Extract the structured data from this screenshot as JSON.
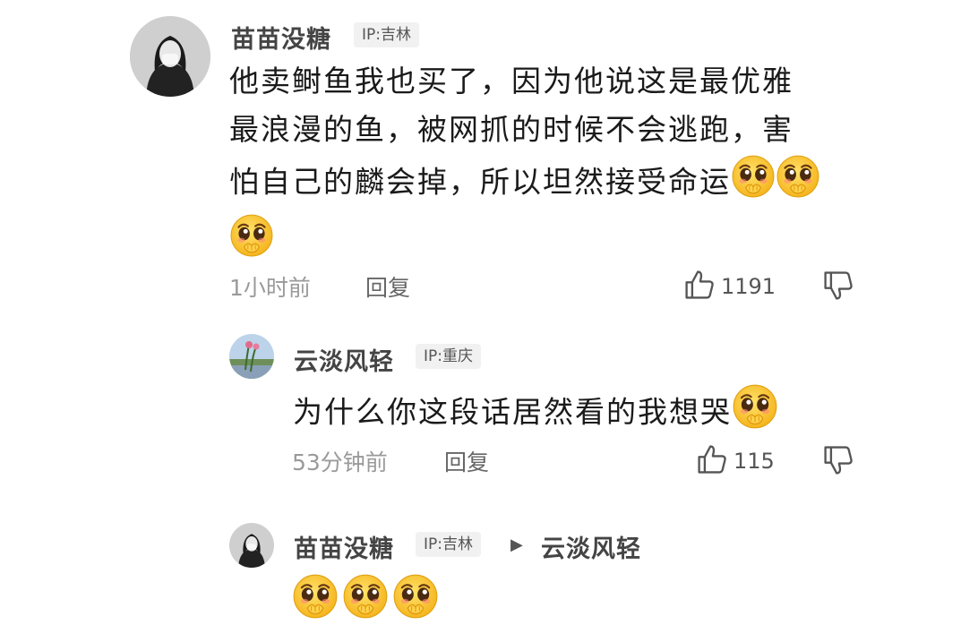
{
  "comment": {
    "user": "苗苗没糖",
    "ip": "IP:吉林",
    "lines": [
      "他卖鲥鱼我也买了，因为他说这是最优雅",
      "最浪漫的鱼，被网抓的时候不会逃跑，害",
      "怕自己的麟会掉，所以坦然接受命运"
    ],
    "time": "1小时前",
    "reply_label": "回复",
    "likes": "1191"
  },
  "reply1": {
    "user": "云淡风轻",
    "ip": "IP:重庆",
    "text": "为什么你这段话居然看的我想哭",
    "time": "53分钟前",
    "reply_label": "回复",
    "likes": "115"
  },
  "reply2": {
    "user": "苗苗没糖",
    "ip": "IP:吉林",
    "arrow": "▶",
    "target_user": "云淡风轻"
  },
  "emoji_name": "pleading-face-icon",
  "colors": {
    "emoji_yellow": "#ffcf3f",
    "like_icon": "#555555",
    "ip_bg": "#f1f1f1"
  }
}
